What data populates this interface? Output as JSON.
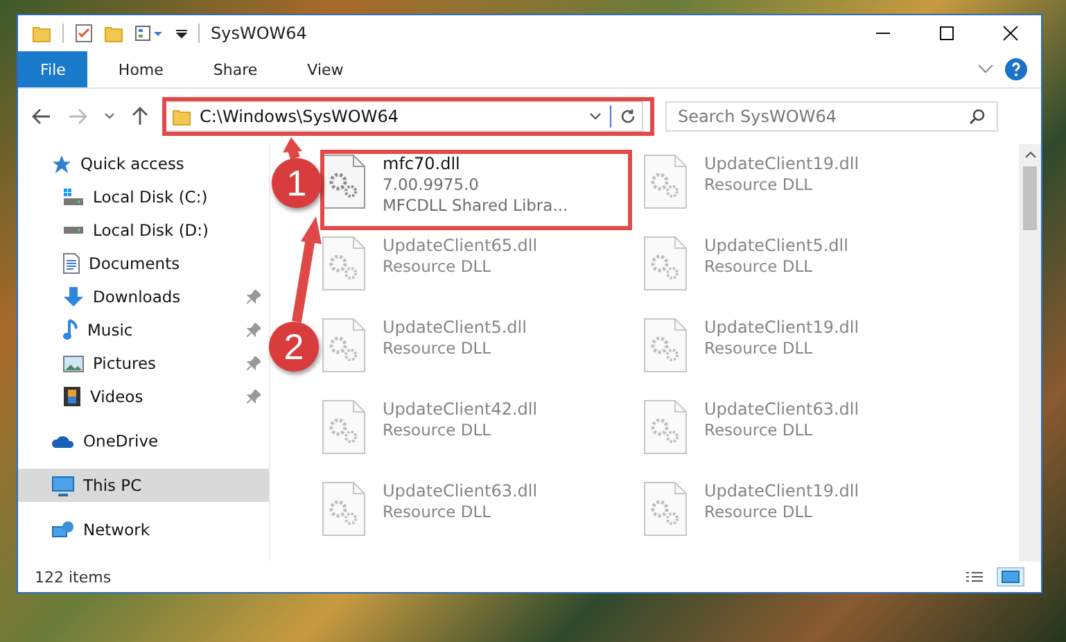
{
  "window": {
    "title": "SysWOW64"
  },
  "ribbon_tabs": [
    {
      "label": "File",
      "selected": true
    },
    {
      "label": "Home",
      "selected": false
    },
    {
      "label": "Share",
      "selected": false
    },
    {
      "label": "View",
      "selected": false
    }
  ],
  "address_bar": {
    "path": "C:\\Windows\\SysWOW64"
  },
  "search": {
    "placeholder": "Search SysWOW64"
  },
  "sidebar": {
    "items": [
      {
        "label": "Quick access",
        "kind": "star",
        "selected": false,
        "children": [
          {
            "label": "Local Disk (C:)",
            "kind": "drive-c",
            "pinned": false,
            "selected": false
          },
          {
            "label": "Local Disk (D:)",
            "kind": "drive",
            "pinned": false,
            "selected": false
          },
          {
            "label": "Documents",
            "kind": "documents",
            "pinned": false,
            "selected": false
          },
          {
            "label": "Downloads",
            "kind": "downloads",
            "pinned": true,
            "selected": false
          },
          {
            "label": "Music",
            "kind": "music",
            "pinned": true,
            "selected": false
          },
          {
            "label": "Pictures",
            "kind": "pictures",
            "pinned": true,
            "selected": false
          },
          {
            "label": "Videos",
            "kind": "videos",
            "pinned": true,
            "selected": false
          }
        ]
      },
      {
        "label": "OneDrive",
        "kind": "cloud",
        "selected": false
      },
      {
        "label": "This PC",
        "kind": "pc",
        "selected": true
      },
      {
        "label": "Network",
        "kind": "network",
        "selected": false
      }
    ]
  },
  "files": [
    {
      "name": "mfc70.dll",
      "details": [
        "7.00.9975.0",
        "MFCDLL Shared Libra..."
      ],
      "blurred": false
    },
    {
      "name": "UpdateClient19.dll",
      "details": [
        "Resource DLL"
      ],
      "blurred": true
    },
    {
      "name": "UpdateClient65.dll",
      "details": [
        "Resource DLL"
      ],
      "blurred": true
    },
    {
      "name": "UpdateClient5.dll",
      "details": [
        "Resource DLL"
      ],
      "blurred": true
    },
    {
      "name": "UpdateClient5.dll",
      "details": [
        "Resource DLL"
      ],
      "blurred": true
    },
    {
      "name": "UpdateClient19.dll",
      "details": [
        "Resource DLL"
      ],
      "blurred": true
    },
    {
      "name": "UpdateClient42.dll",
      "details": [
        "Resource DLL"
      ],
      "blurred": true
    },
    {
      "name": "UpdateClient63.dll",
      "details": [
        "Resource DLL"
      ],
      "blurred": true
    },
    {
      "name": "UpdateClient63.dll",
      "details": [
        "Resource DLL"
      ],
      "blurred": true
    },
    {
      "name": "UpdateClient19.dll",
      "details": [
        "Resource DLL"
      ],
      "blurred": true
    }
  ],
  "status_bar": {
    "item_count": "122 items"
  },
  "view_buttons": [
    {
      "kind": "details",
      "selected": false
    },
    {
      "kind": "tiles",
      "selected": true
    }
  ],
  "annotations": [
    {
      "label": "1"
    },
    {
      "label": "2"
    }
  ]
}
